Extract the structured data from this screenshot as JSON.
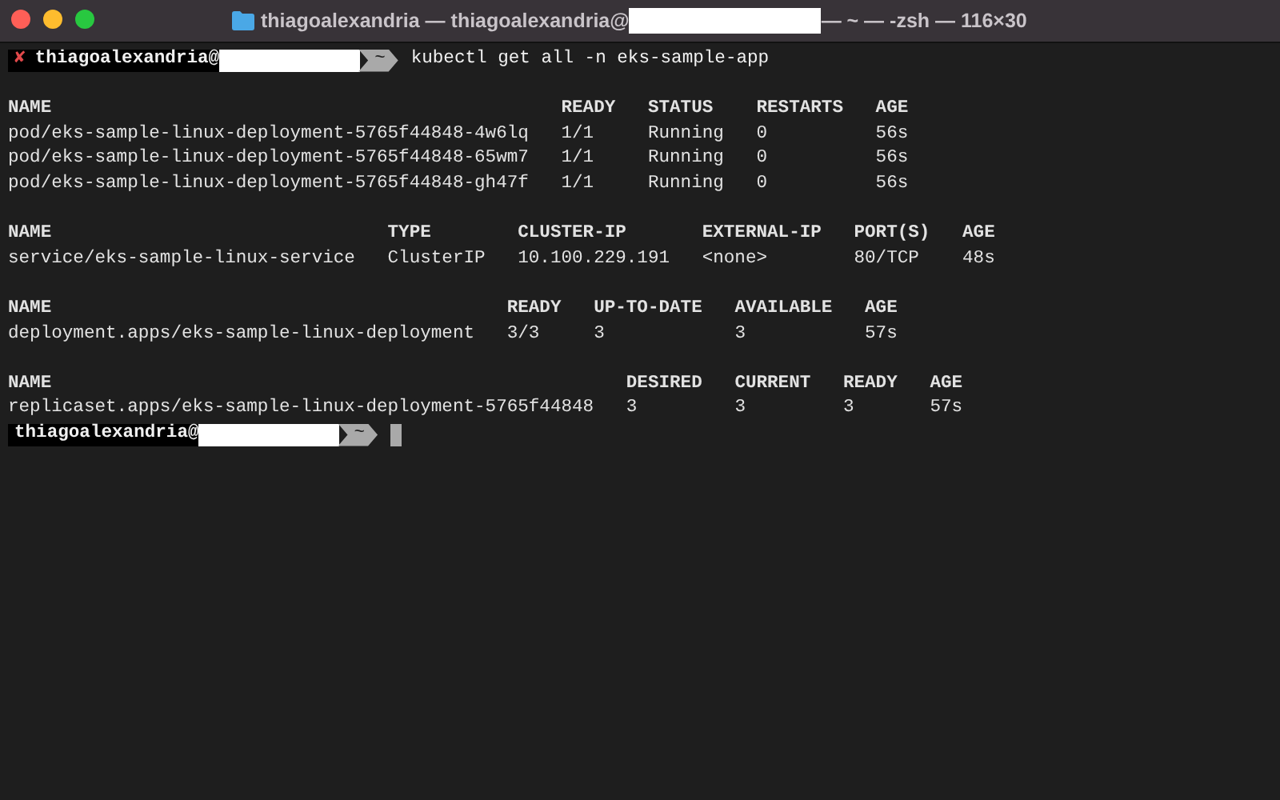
{
  "window": {
    "title_start": "thiagoalexandria — thiagoalexandria@",
    "title_end": "— ~ — -zsh — 116×30"
  },
  "prompts": [
    {
      "failed": true,
      "mark": "✘",
      "user": "thiagoalexandria@",
      "dir": "~",
      "command": "kubectl get all -n eks-sample-app"
    }
  ],
  "tables": [
    {
      "columns": [
        "NAME",
        "READY",
        "STATUS",
        "RESTARTS",
        "AGE"
      ],
      "rows": [
        [
          "pod/eks-sample-linux-deployment-5765f44848-4w6lq",
          "1/1",
          "Running",
          "0",
          "56s"
        ],
        [
          "pod/eks-sample-linux-deployment-5765f44848-65wm7",
          "1/1",
          "Running",
          "0",
          "56s"
        ],
        [
          "pod/eks-sample-linux-deployment-5765f44848-gh47f",
          "1/1",
          "Running",
          "0",
          "56s"
        ]
      ]
    },
    {
      "columns": [
        "NAME",
        "TYPE",
        "CLUSTER-IP",
        "EXTERNAL-IP",
        "PORT(S)",
        "AGE"
      ],
      "rows": [
        [
          "service/eks-sample-linux-service",
          "ClusterIP",
          "10.100.229.191",
          "<none>",
          "80/TCP",
          "48s"
        ]
      ]
    },
    {
      "columns": [
        "NAME",
        "READY",
        "UP-TO-DATE",
        "AVAILABLE",
        "AGE"
      ],
      "rows": [
        [
          "deployment.apps/eks-sample-linux-deployment",
          "3/3",
          "3",
          "3",
          "57s"
        ]
      ]
    },
    {
      "columns": [
        "NAME",
        "DESIRED",
        "CURRENT",
        "READY",
        "AGE"
      ],
      "rows": [
        [
          "replicaset.apps/eks-sample-linux-deployment-5765f44848",
          "3",
          "3",
          "3",
          "57s"
        ]
      ]
    }
  ],
  "final_prompt": {
    "failed": false,
    "user": "thiagoalexandria@",
    "dir": "~"
  }
}
